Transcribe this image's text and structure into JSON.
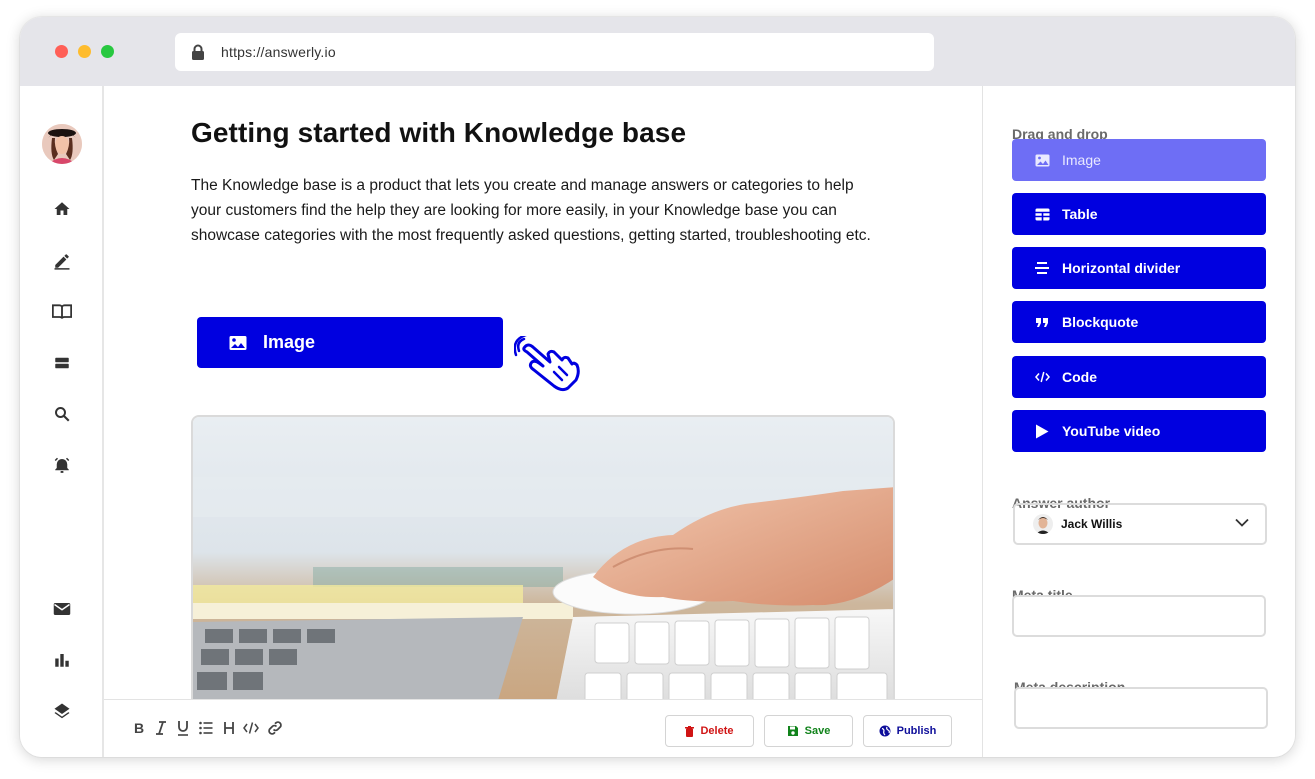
{
  "browser": {
    "url": "https://answerly.io"
  },
  "editor": {
    "title": "Getting started with Knowledge base",
    "body": "The Knowledge base is a product that lets you create and manage answers or categories to help your customers find the help they are looking for more easily, in your Knowledge base you can showcase categories with the most frequently asked questions, getting started, troubleshooting etc.",
    "dragged_block_label": "Image"
  },
  "toolbar": {
    "format_icons": [
      "bold-icon",
      "italic-icon",
      "underline-icon",
      "list-icon",
      "heading-icon",
      "code-icon",
      "link-icon"
    ],
    "delete_label": "Delete",
    "save_label": "Save",
    "publish_label": "Publish"
  },
  "panel": {
    "drag_heading": "Drag and drop",
    "blocks": [
      {
        "label": "Image",
        "icon": "image-icon",
        "state": "dragging"
      },
      {
        "label": "Table",
        "icon": "table-icon"
      },
      {
        "label": "Horizontal divider",
        "icon": "divider-icon"
      },
      {
        "label": "Blockquote",
        "icon": "quote-icon"
      },
      {
        "label": "Code",
        "icon": "code-icon"
      },
      {
        "label": "YouTube video",
        "icon": "play-icon"
      }
    ],
    "author_label": "Answer author",
    "author_value": "Jack Willis",
    "meta_title_label": "Meta title",
    "meta_title_value": "",
    "meta_description_label": "Meta description",
    "meta_description_value": ""
  },
  "sidebar": {
    "icons": [
      "home-icon",
      "edit-icon",
      "book-icon",
      "storage-icon",
      "search-icon",
      "alarm-icon",
      "mail-icon",
      "bar-chart-icon",
      "layers-icon"
    ]
  },
  "colors": {
    "accent": "#0000e0",
    "accent_light": "#6e6ef5",
    "delete": "#d01414",
    "save": "#11831b",
    "publish": "#0e0e9a"
  }
}
